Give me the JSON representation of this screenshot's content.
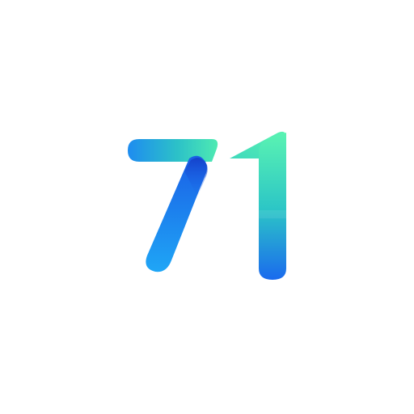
{
  "logo": {
    "text": "71",
    "colors": {
      "blue": "#1E6BF0",
      "blue_light": "#1FA2F5",
      "teal": "#2CC9C0",
      "green": "#55F0B0",
      "dark_fold": "#1655D8"
    },
    "icon": "number-71-logo"
  }
}
